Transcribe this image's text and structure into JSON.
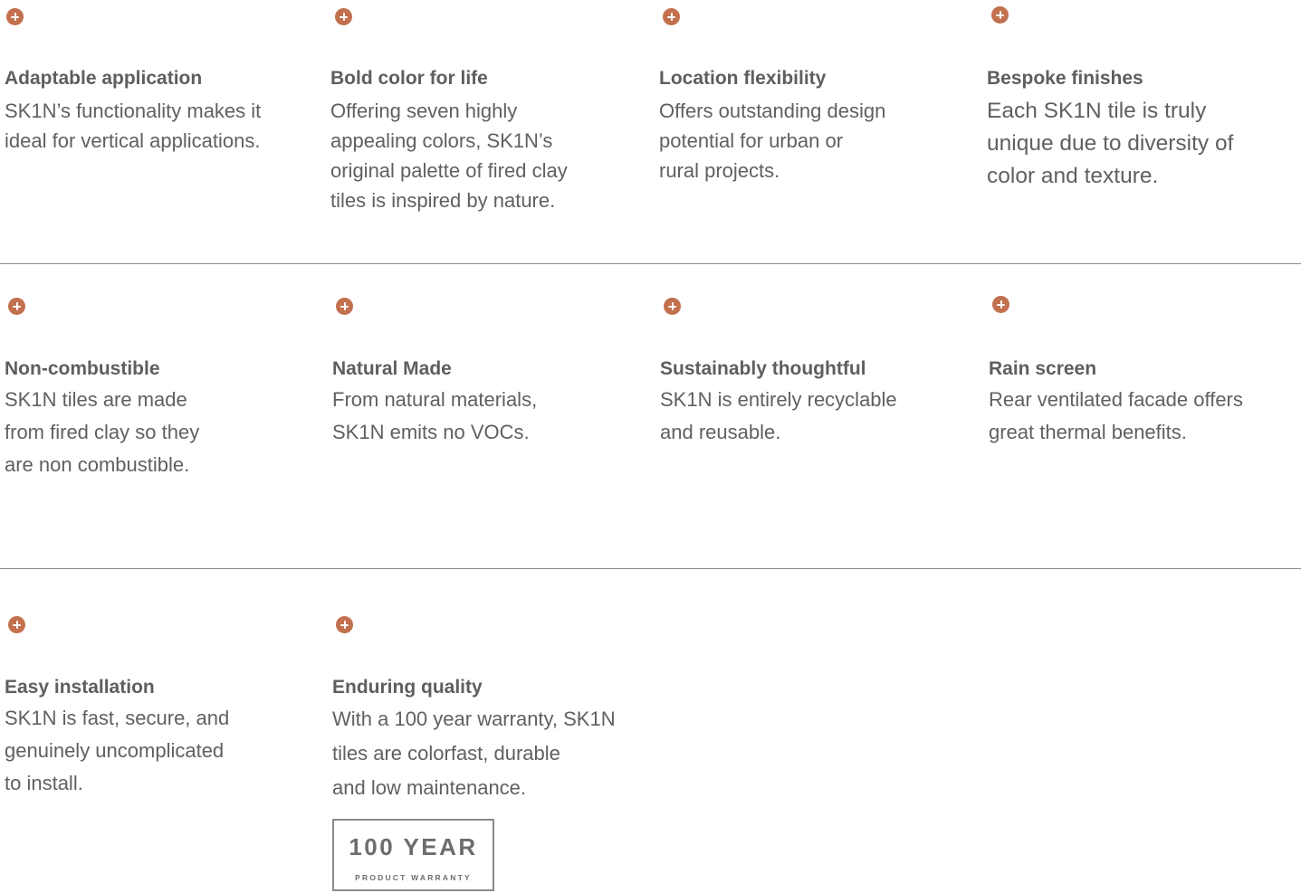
{
  "rows": [
    [
      {
        "title": "Adaptable application",
        "desc": "SK1N’s functionality makes it\nideal for vertical applications."
      },
      {
        "title": "Bold color for life",
        "desc": "Offering seven highly\nappealing colors, SK1N’s\noriginal palette of fired clay\ntiles is inspired by nature."
      },
      {
        "title": "Location flexibility",
        "desc": "Offers outstanding design\npotential for urban or\nrural projects."
      },
      {
        "title": "Bespoke finishes",
        "desc": "Each SK1N tile is truly\nunique due to diversity of\ncolor and texture."
      }
    ],
    [
      {
        "title": "Non-combustible",
        "desc": "SK1N tiles are made\nfrom fired clay so they\nare non combustible."
      },
      {
        "title": "Natural Made",
        "desc": "From natural materials,\nSK1N emits no VOCs."
      },
      {
        "title": "Sustainably thoughtful",
        "desc": "SK1N is entirely recyclable\nand reusable."
      },
      {
        "title": "Rain screen",
        "desc": "Rear ventilated facade offers\ngreat thermal benefits."
      }
    ],
    [
      {
        "title": "Easy installation",
        "desc": "SK1N is fast, secure, and\ngenuinely uncomplicated\nto install."
      },
      {
        "title": "Enduring quality",
        "desc": "With a 100 year warranty, SK1N\ntiles are colorfast, durable\nand low maintenance."
      }
    ]
  ],
  "badge": {
    "big": "100 YEAR",
    "small": "PRODUCT WARRANTY"
  },
  "colors": {
    "accent": "#c2704e",
    "text": "#5e5e5e",
    "divider": "#8a8a8a"
  },
  "icons": {
    "expand": "plus-circle-icon"
  }
}
